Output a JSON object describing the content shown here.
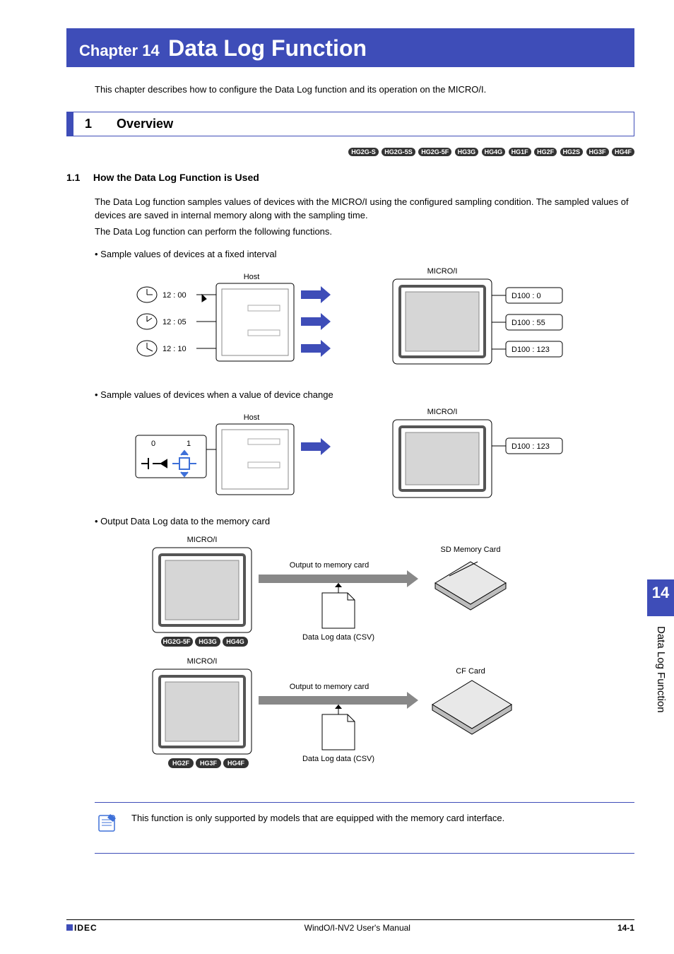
{
  "chapter": {
    "pre": "Chapter 14",
    "title": "Data Log Function"
  },
  "intro": "This chapter describes how to configure the Data Log function and its operation on the MICRO/I.",
  "section": {
    "num": "1",
    "title": "Overview"
  },
  "badges": [
    "HG2G-S",
    "HG2G-5S",
    "HG2G-5F",
    "HG3G",
    "HG4G",
    "HG1F",
    "HG2F",
    "HG2S",
    "HG3F",
    "HG4F"
  ],
  "subsection": {
    "num": "1.1",
    "title": "How the Data Log Function is Used"
  },
  "paras": [
    "The Data Log function samples values of devices with the MICRO/I using the configured sampling condition. The sampled values of devices are saved in internal memory along with the sampling time.",
    "The Data Log function can perform the following functions."
  ],
  "bullets": [
    "Sample values of devices at a fixed interval",
    "Sample values of devices when a value of device change",
    "Output Data Log data to the memory card"
  ],
  "diag1": {
    "host": "Host",
    "micro": "MICRO/I",
    "times": [
      "12 : 00",
      "12 : 05",
      "12 : 10"
    ],
    "vals": [
      "D100 : 0",
      "D100 : 55",
      "D100 : 123"
    ]
  },
  "diag2": {
    "host": "Host",
    "micro": "MICRO/I",
    "zero": "0",
    "one": "1",
    "val": "D100 : 123"
  },
  "diag3": {
    "micro": "MICRO/I",
    "out": "Output to memory card",
    "csv": "Data Log data (CSV)",
    "sd": "SD Memory Card",
    "cf": "CF Card",
    "badgesA": [
      "HG2G-5F",
      "HG3G",
      "HG4G"
    ],
    "badgesB": [
      "HG2F",
      "HG3F",
      "HG4F"
    ]
  },
  "note": "This function is only supported by models that are equipped with the memory card interface.",
  "sidetab": {
    "num": "14",
    "label": "Data Log Function"
  },
  "footer": {
    "brand": "IDEC",
    "manual": "WindO/I-NV2 User's Manual",
    "page": "14-1"
  }
}
